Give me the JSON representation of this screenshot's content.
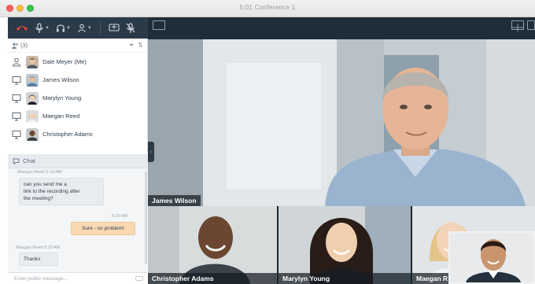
{
  "window": {
    "title": "5:01 Conference 1"
  },
  "toolbar": {
    "items": [
      {
        "icon": "hang-up-icon",
        "color": "#e8453c"
      },
      {
        "icon": "microphone-icon"
      },
      {
        "icon": "headset-icon"
      },
      {
        "icon": "people-icon"
      },
      {
        "icon": "screen-share-icon"
      },
      {
        "icon": "mute-icon"
      }
    ]
  },
  "participants": {
    "header_count": "(3)",
    "list": [
      {
        "name": "Dale Meyer (Me)",
        "device": "person-icon"
      },
      {
        "name": "James Wilson",
        "device": "monitor-icon"
      },
      {
        "name": "Marylyn Young",
        "device": "monitor-icon"
      },
      {
        "name": "Maegan Reed",
        "device": "monitor-icon"
      },
      {
        "name": "Christopher Adams",
        "device": "monitor-icon"
      }
    ]
  },
  "chat": {
    "title": "Chat",
    "messages": [
      {
        "meta": "Maegan Reed  5:10 AM",
        "lines": [
          "can you send me a",
          "link to the recording after",
          "the meeting?"
        ],
        "direction": "in"
      },
      {
        "meta": "5:10 AM",
        "lines": [
          "Sure - no problem!"
        ],
        "direction": "out"
      },
      {
        "meta": "Maegan Reed  5:10 AM",
        "lines": [
          "Thanks"
        ],
        "direction": "in"
      }
    ],
    "input_placeholder": "Enter public message..."
  },
  "video": {
    "main": {
      "name": "James Wilson"
    },
    "thumbnails": [
      {
        "name": "Christopher Adams"
      },
      {
        "name": "Marylyn Young"
      },
      {
        "name": "Maegan R"
      }
    ],
    "top_icons": [
      "layout-grid-icon",
      "layout-speaker-icon",
      "screen-icon"
    ]
  },
  "colors": {
    "toolbar_bg": "#2b3a47",
    "video_bg": "#1c2933",
    "bubble_out": "#fad8b2",
    "hang_up": "#e8453c"
  }
}
